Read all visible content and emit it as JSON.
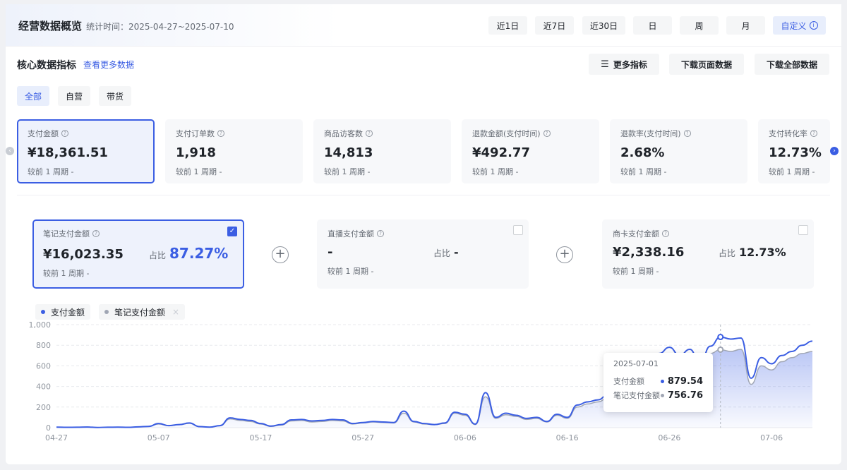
{
  "header": {
    "title": "经营数据概览",
    "stat_time": "统计时间：2025-04-27~2025-07-10",
    "ranges": [
      "近1日",
      "近7日",
      "近30日",
      "日",
      "周",
      "月",
      "自定义"
    ],
    "active_range": "自定义"
  },
  "core": {
    "title": "核心数据指标",
    "more_link": "查看更多数据",
    "more_metrics": "更多指标",
    "download_page": "下载页面数据",
    "download_all": "下载全部数据"
  },
  "filters": [
    "全部",
    "自营",
    "带货"
  ],
  "kpis": [
    {
      "label": "支付金额",
      "value": "¥18,361.51",
      "compare": "较前 1 周期  -"
    },
    {
      "label": "支付订单数",
      "value": "1,918",
      "compare": "较前 1 周期  -"
    },
    {
      "label": "商品访客数",
      "value": "14,813",
      "compare": "较前 1 周期  -"
    },
    {
      "label": "退款金额(支付时间)",
      "value": "¥492.77",
      "compare": "较前 1 周期  -"
    },
    {
      "label": "退款率(支付时间)",
      "value": "2.68%",
      "compare": "较前 1 周期  -"
    },
    {
      "label": "支付转化率",
      "value": "12.73%",
      "compare": "较前 1 周期  -"
    }
  ],
  "sources": [
    {
      "label": "笔记支付金额",
      "value": "¥16,023.35",
      "share_label": "占比",
      "share": "87.27%",
      "compare": "较前 1 周期  -",
      "checked": true
    },
    {
      "label": "直播支付金额",
      "value": "-",
      "share_label": "占比",
      "share": "-",
      "compare": "较前 1 周期  -",
      "checked": false
    },
    {
      "label": "商卡支付金额",
      "value": "¥2,338.16",
      "share_label": "占比",
      "share": "12.73%",
      "compare": "较前 1 周期  -",
      "checked": false
    }
  ],
  "legend": [
    "支付金额",
    "笔记支付金额"
  ],
  "colors": {
    "accent": "#3b5ee3",
    "secondary": "#a0a6b4"
  },
  "tooltip": {
    "date": "2025-07-01",
    "rows": [
      {
        "name": "支付金额",
        "value": "879.54"
      },
      {
        "name": "笔记支付金额",
        "value": "756.76"
      }
    ]
  },
  "chart_data": {
    "type": "area",
    "y_ticks": [
      "1,000",
      "800",
      "600",
      "400",
      "200",
      "0"
    ],
    "ylim": [
      0,
      1000
    ],
    "x_ticks": [
      "04-27",
      "05-07",
      "05-17",
      "05-27",
      "06-06",
      "06-16",
      "06-26",
      "07-06"
    ],
    "x": [
      "04-27",
      "04-28",
      "04-29",
      "04-30",
      "05-01",
      "05-02",
      "05-03",
      "05-04",
      "05-05",
      "05-06",
      "05-07",
      "05-08",
      "05-09",
      "05-10",
      "05-11",
      "05-12",
      "05-13",
      "05-14",
      "05-15",
      "05-16",
      "05-17",
      "05-18",
      "05-19",
      "05-20",
      "05-21",
      "05-22",
      "05-23",
      "05-24",
      "05-25",
      "05-26",
      "05-27",
      "05-28",
      "05-29",
      "05-30",
      "05-31",
      "06-01",
      "06-02",
      "06-03",
      "06-04",
      "06-05",
      "06-06",
      "06-07",
      "06-08",
      "06-09",
      "06-10",
      "06-11",
      "06-12",
      "06-13",
      "06-14",
      "06-15",
      "06-16",
      "06-17",
      "06-18",
      "06-19",
      "06-20",
      "06-21",
      "06-22",
      "06-23",
      "06-24",
      "06-25",
      "06-26",
      "06-27",
      "06-28",
      "06-29",
      "06-30",
      "07-01",
      "07-02",
      "07-03",
      "07-04",
      "07-05",
      "07-06",
      "07-07",
      "07-08",
      "07-09",
      "07-10"
    ],
    "series": [
      {
        "name": "支付金额",
        "values": [
          5,
          3,
          4,
          6,
          2,
          4,
          5,
          3,
          8,
          12,
          40,
          20,
          30,
          45,
          10,
          5,
          20,
          95,
          80,
          70,
          40,
          15,
          30,
          75,
          80,
          65,
          70,
          80,
          75,
          40,
          50,
          60,
          55,
          50,
          160,
          60,
          40,
          30,
          45,
          150,
          130,
          35,
          340,
          100,
          140,
          120,
          90,
          100,
          60,
          130,
          100,
          220,
          250,
          270,
          320,
          390,
          330,
          390,
          650,
          720,
          780,
          700,
          760,
          620,
          790,
          880,
          860,
          870,
          480,
          680,
          620,
          700,
          740,
          800,
          840
        ]
      },
      {
        "name": "笔记支付金额",
        "values": [
          5,
          3,
          4,
          6,
          2,
          4,
          5,
          3,
          8,
          12,
          35,
          18,
          28,
          42,
          10,
          5,
          18,
          85,
          70,
          60,
          35,
          12,
          25,
          65,
          70,
          55,
          60,
          70,
          65,
          35,
          45,
          55,
          50,
          45,
          140,
          55,
          35,
          28,
          40,
          140,
          120,
          30,
          300,
          90,
          125,
          110,
          80,
          90,
          55,
          120,
          90,
          200,
          230,
          250,
          290,
          350,
          300,
          360,
          590,
          650,
          700,
          640,
          690,
          570,
          720,
          757,
          740,
          760,
          420,
          600,
          560,
          640,
          680,
          720,
          740
        ]
      }
    ]
  }
}
